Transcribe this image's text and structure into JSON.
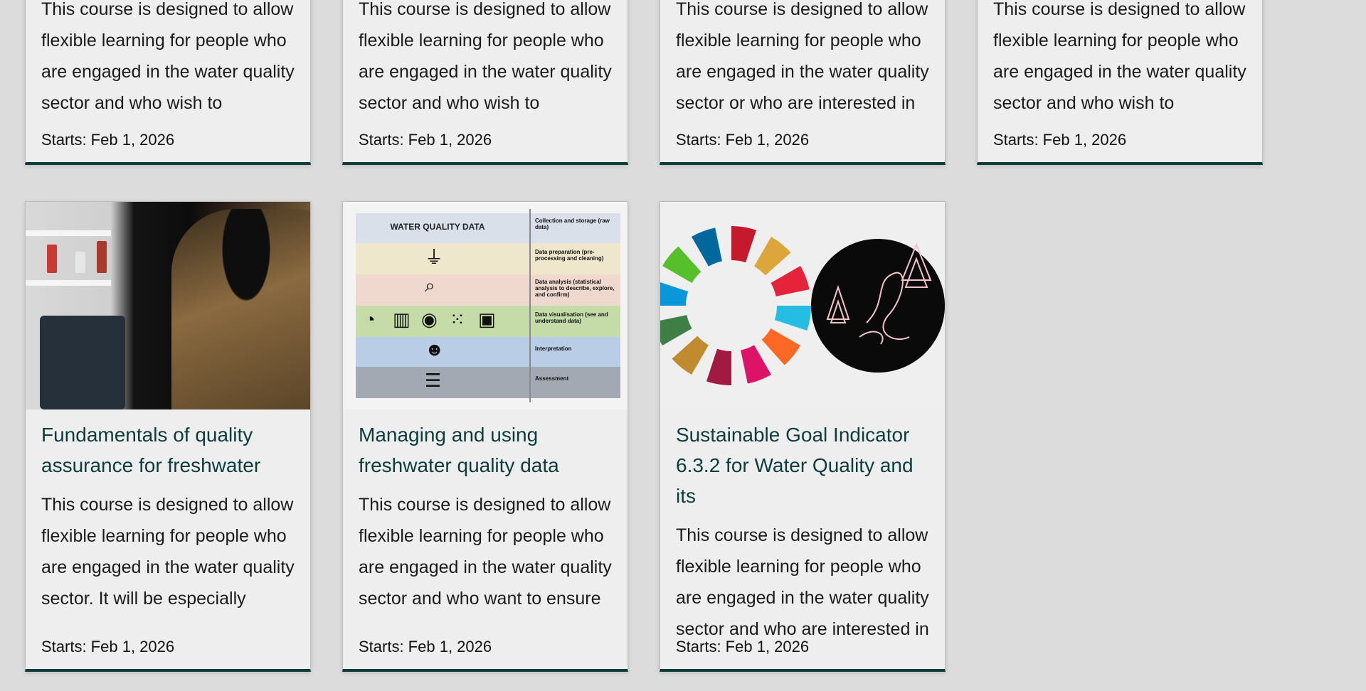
{
  "top_cards": [
    {
      "description": "This course is designed to allow flexible learning for people who are engaged in the water quality sector and who wish to strengthen",
      "starts": "Starts: Feb 1, 2026"
    },
    {
      "description": "This course is designed to allow flexible learning for people who are engaged in the water quality sector and who wish to strengthen",
      "starts": "Starts: Feb 1, 2026"
    },
    {
      "description": "This course is designed to allow flexible learning for people who are engaged in the water quality sector or who are interested in",
      "starts": "Starts: Feb 1, 2026"
    },
    {
      "description": "This course is designed to allow flexible learning for people who are engaged in the water quality sector and who wish to",
      "starts": "Starts: Feb 1, 2026"
    }
  ],
  "bottom_cards": [
    {
      "title": "Fundamentals of quality assurance for freshwater",
      "description": "This course is designed to allow flexible learning for people who are engaged in the water quality sector. It will be especially useful",
      "starts": "Starts: Feb 1, 2026",
      "image_icon": "lab-photo-icon"
    },
    {
      "title": "Managing and using freshwater quality data",
      "description": "This course is designed to allow flexible learning for people who are engaged in the water quality sector and who want to ensure",
      "starts": "Starts: Feb 1, 2026",
      "image_icon": "water-data-infographic-icon"
    },
    {
      "title": "Sustainable Goal Indicator 6.3.2 for Water Quality and its",
      "description": "This course is designed to allow flexible learning for people who are engaged in the water quality sector and who are interested in",
      "starts": "Starts: Feb 1, 2026",
      "image_icon": "sdg-wheel-icon"
    }
  ],
  "infographic": {
    "title": "WATER QUALITY DATA",
    "labels": [
      "Collection and storage (raw data)",
      "Data preparation (pre-processing and cleaning)",
      "Data analysis (statistical analysis to describe, explore, and confirm)",
      "Data visualisation (see and understand data)",
      "Interpretation",
      "Assessment"
    ]
  },
  "colors": {
    "card_bg": "#eeeeee",
    "title": "#0d3c3c",
    "border_bottom": "#0d3c3c",
    "page_bg": "#dcdcdc"
  }
}
